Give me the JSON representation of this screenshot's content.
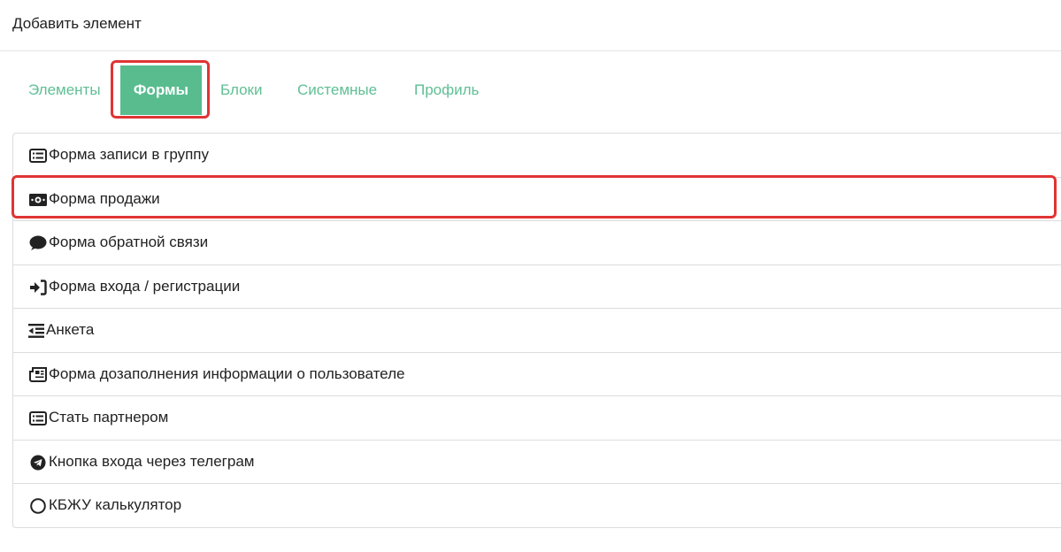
{
  "modal": {
    "title": "Добавить элемент"
  },
  "tabs": [
    {
      "label": "Элементы",
      "active": false
    },
    {
      "label": "Формы",
      "active": true
    },
    {
      "label": "Блоки",
      "active": false
    },
    {
      "label": "Системные",
      "active": false
    },
    {
      "label": "Профиль",
      "active": false
    }
  ],
  "items": [
    {
      "label": "Форма записи в группу",
      "icon": "list-alt-icon"
    },
    {
      "label": "Форма продажи",
      "icon": "money-bill-icon"
    },
    {
      "label": "Форма обратной связи",
      "icon": "comment-icon"
    },
    {
      "label": "Форма входа / регистрации",
      "icon": "sign-in-icon"
    },
    {
      "label": "Анкета",
      "icon": "outdent-icon"
    },
    {
      "label": "Форма дозаполнения информации о пользователе",
      "icon": "newspaper-icon"
    },
    {
      "label": "Стать партнером",
      "icon": "list-alt-icon"
    },
    {
      "label": "Кнопка входа через телеграм",
      "icon": "telegram-icon"
    },
    {
      "label": "КБЖУ калькулятор",
      "icon": "circle-icon"
    }
  ],
  "colors": {
    "accent": "#58bc8f",
    "tab_text": "#5fbf94",
    "highlight": "#e03434"
  }
}
